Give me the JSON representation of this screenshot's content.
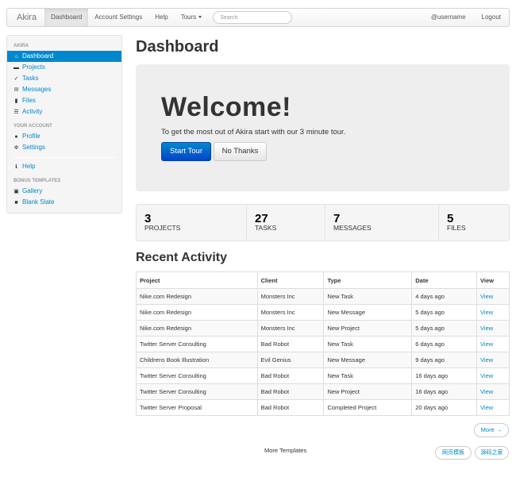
{
  "navbar": {
    "brand": "Akira",
    "items": [
      "Dashboard",
      "Account Settings",
      "Help"
    ],
    "tours_label": "Tours",
    "search_placeholder": "Search",
    "username": "@username",
    "logout": "Logout"
  },
  "sidebar": {
    "sections": [
      {
        "header": "AKIRA",
        "items": [
          {
            "label": "Dashboard",
            "icon": "home-icon",
            "active": true
          },
          {
            "label": "Projects",
            "icon": "folder-icon"
          },
          {
            "label": "Tasks",
            "icon": "check-icon"
          },
          {
            "label": "Messages",
            "icon": "envelope-icon"
          },
          {
            "label": "Files",
            "icon": "file-icon"
          },
          {
            "label": "Activity",
            "icon": "list-icon"
          }
        ]
      },
      {
        "header": "YOUR ACCOUNT",
        "items": [
          {
            "label": "Profile",
            "icon": "user-icon"
          },
          {
            "label": "Settings",
            "icon": "gear-icon"
          },
          {
            "label": "Help",
            "icon": "info-icon"
          }
        ]
      },
      {
        "header": "BONUS TEMPLATES",
        "items": [
          {
            "label": "Gallery",
            "icon": "picture-icon"
          },
          {
            "label": "Blank Slate",
            "icon": "stop-icon"
          }
        ]
      }
    ]
  },
  "main": {
    "title": "Dashboard",
    "hero": {
      "title": "Welcome!",
      "text": "To get the most out of Akira start with our 3 minute tour.",
      "start_label": "Start Tour",
      "dismiss_label": "No Thanks"
    },
    "stats": [
      {
        "value": "3",
        "label": "PROJECTS"
      },
      {
        "value": "27",
        "label": "TASKS"
      },
      {
        "value": "7",
        "label": "MESSAGES"
      },
      {
        "value": "5",
        "label": "FILES"
      }
    ],
    "activity": {
      "title": "Recent Activity",
      "headers": [
        "Project",
        "Client",
        "Type",
        "Date",
        "View"
      ],
      "rows": [
        [
          "Nike.com Redesign",
          "Monsters Inc",
          "New Task",
          "4 days ago",
          "View"
        ],
        [
          "Nike.com Redesign",
          "Monsters Inc",
          "New Message",
          "5 days ago",
          "View"
        ],
        [
          "Nike.com Redesign",
          "Monsters Inc",
          "New Project",
          "5 days ago",
          "View"
        ],
        [
          "Twitter Server Consulting",
          "Bad Robot",
          "New Task",
          "6 days ago",
          "View"
        ],
        [
          "Childrens Book Illustration",
          "Evil Genius",
          "New Message",
          "9 days ago",
          "View"
        ],
        [
          "Twitter Server Consulting",
          "Bad Robot",
          "New Task",
          "16 days ago",
          "View"
        ],
        [
          "Twitter Server Consulting",
          "Bad Robot",
          "New Project",
          "16 days ago",
          "View"
        ],
        [
          "Twitter Server Proposal",
          "Bad Robot",
          "Completed Project",
          "20 days ago",
          "View"
        ]
      ],
      "more_label": "More →"
    }
  },
  "footer": {
    "more_templates": "More Templates",
    "buttons": [
      "网页模板",
      "源码之家"
    ]
  },
  "colors": {
    "accent": "#0088cc",
    "primary_dark": "#0044cc",
    "hero_bg": "#eeeeee",
    "sidebar_bg": "#f5f5f5"
  }
}
